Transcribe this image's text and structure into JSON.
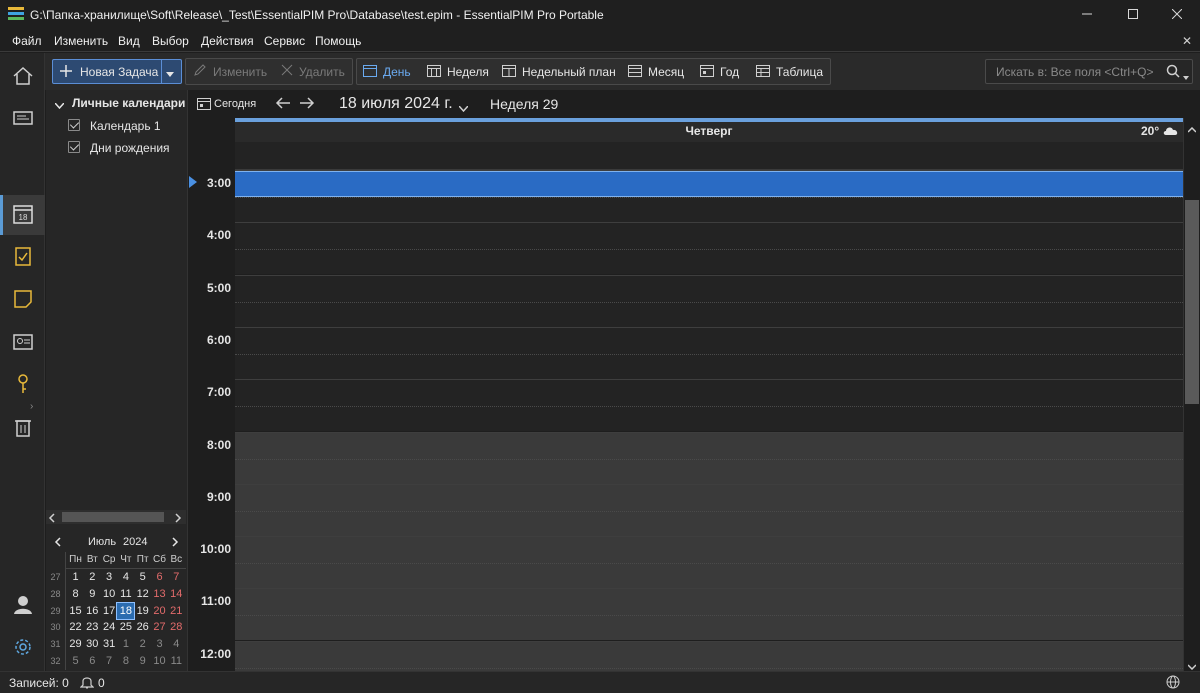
{
  "window": {
    "title": "G:\\Папка-хранилище\\Soft\\Release\\_Test\\EssentialPIM Pro\\Database\\test.epim - EssentialPIM Pro Portable",
    "minimize_icon": "minimize-icon",
    "maximize_icon": "maximize-icon",
    "close_icon": "close-icon"
  },
  "menu": {
    "items": [
      "Файл",
      "Изменить",
      "Вид",
      "Выбор",
      "Действия",
      "Сервис",
      "Помощь"
    ],
    "close_glyph": "✕"
  },
  "toolbar": {
    "new_task": "Новая Задача",
    "edit": "Изменить",
    "delete": "Удалить",
    "views": [
      "День",
      "Неделя",
      "Недельный план",
      "Месяц",
      "Год",
      "Таблица"
    ],
    "active_view": "День",
    "search_placeholder": "Искать в: Все поля  <Ctrl+Q>"
  },
  "sidebar": {
    "group_label": "Личные календари",
    "calendars": [
      {
        "label": "Календарь 1",
        "checked": true
      },
      {
        "label": "Дни рождения",
        "checked": true
      }
    ]
  },
  "mini_calendar": {
    "month": "Июль",
    "year": "2024",
    "weekdays": [
      "Пн",
      "Вт",
      "Ср",
      "Чт",
      "Пт",
      "Сб",
      "Вс"
    ],
    "weeks": [
      {
        "num": "27",
        "days": [
          "1",
          "2",
          "3",
          "4",
          "5",
          "6",
          "7"
        ]
      },
      {
        "num": "28",
        "days": [
          "8",
          "9",
          "10",
          "11",
          "12",
          "13",
          "14"
        ]
      },
      {
        "num": "29",
        "days": [
          "15",
          "16",
          "17",
          "18",
          "19",
          "20",
          "21"
        ]
      },
      {
        "num": "30",
        "days": [
          "22",
          "23",
          "24",
          "25",
          "26",
          "27",
          "28"
        ]
      },
      {
        "num": "31",
        "days": [
          "29",
          "30",
          "31",
          "1",
          "2",
          "3",
          "4"
        ]
      },
      {
        "num": "32",
        "days": [
          "5",
          "6",
          "7",
          "8",
          "9",
          "10",
          "11"
        ]
      }
    ],
    "today": "18"
  },
  "calendar": {
    "today_button": "Сегодня",
    "date_label": "18 июля 2024 г.",
    "week_label": "Неделя 29",
    "day_name": "Четверг",
    "weather": "20°",
    "hours": [
      "3:00",
      "4:00",
      "5:00",
      "6:00",
      "7:00",
      "8:00",
      "9:00",
      "10:00",
      "11:00",
      "12:00"
    ]
  },
  "status": {
    "records_label": "Записей: 0",
    "reminders_count": "0"
  },
  "colors": {
    "accent": "#2b6cb0",
    "current_time_bar": "#2a6bc4",
    "weekend": "#e26b6b"
  }
}
